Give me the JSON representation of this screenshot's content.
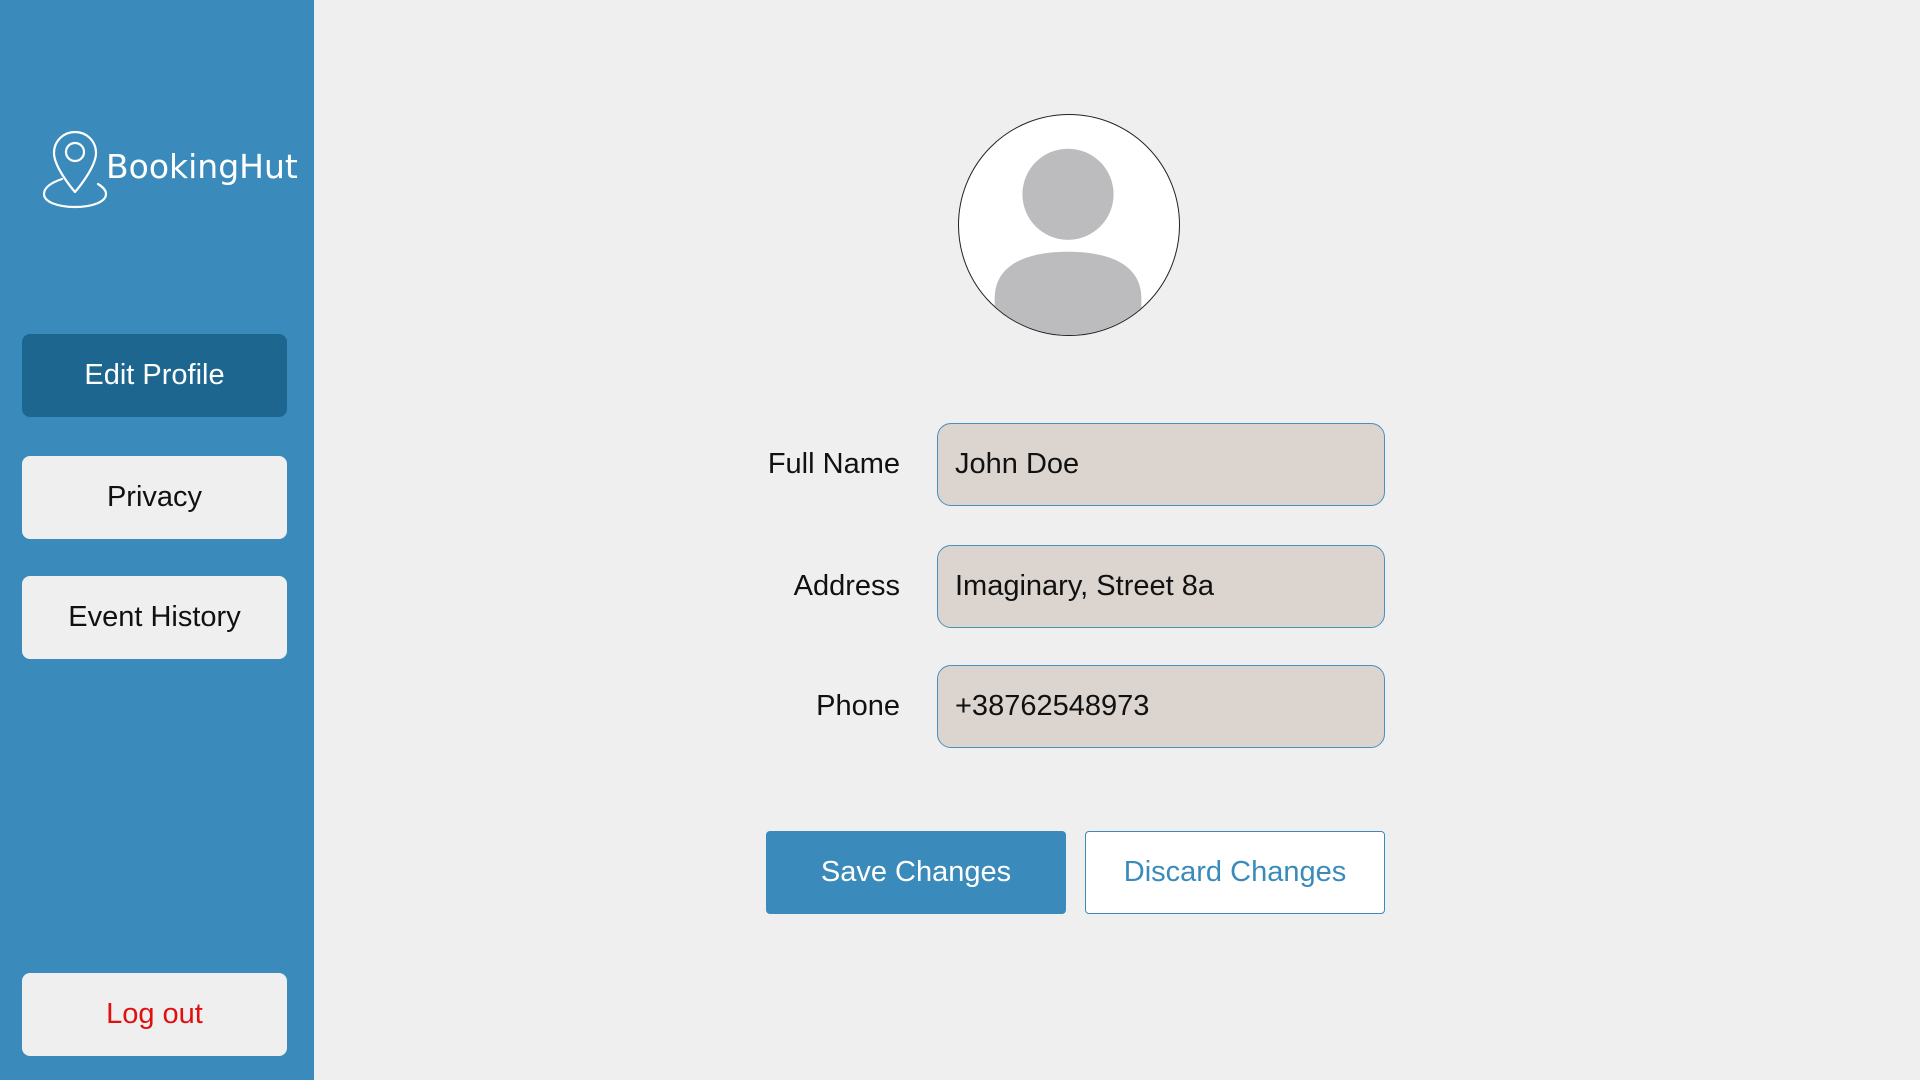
{
  "app": {
    "brand_name": "BookingHut",
    "logo_icon": "map-pin-icon"
  },
  "colors": {
    "sidebar_bg": "#3a8bbb",
    "active_nav_bg": "#1c6690",
    "content_bg": "#efefef",
    "input_bg": "#dbd4cf",
    "input_border": "#4a8fbb",
    "logout_text": "#e01010"
  },
  "sidebar": {
    "items": [
      {
        "label": "Edit Profile",
        "active": true
      },
      {
        "label": "Privacy",
        "active": false
      },
      {
        "label": "Event History",
        "active": false
      }
    ],
    "logout_label": "Log out"
  },
  "profile": {
    "avatar_icon": "user-avatar-icon",
    "fields": [
      {
        "label": "Full Name",
        "value": "John Doe"
      },
      {
        "label": "Address",
        "value": "Imaginary, Street 8a"
      },
      {
        "label": "Phone",
        "value": "+38762548973"
      }
    ]
  },
  "actions": {
    "save_label": "Save Changes",
    "discard_label": "Discard Changes"
  }
}
